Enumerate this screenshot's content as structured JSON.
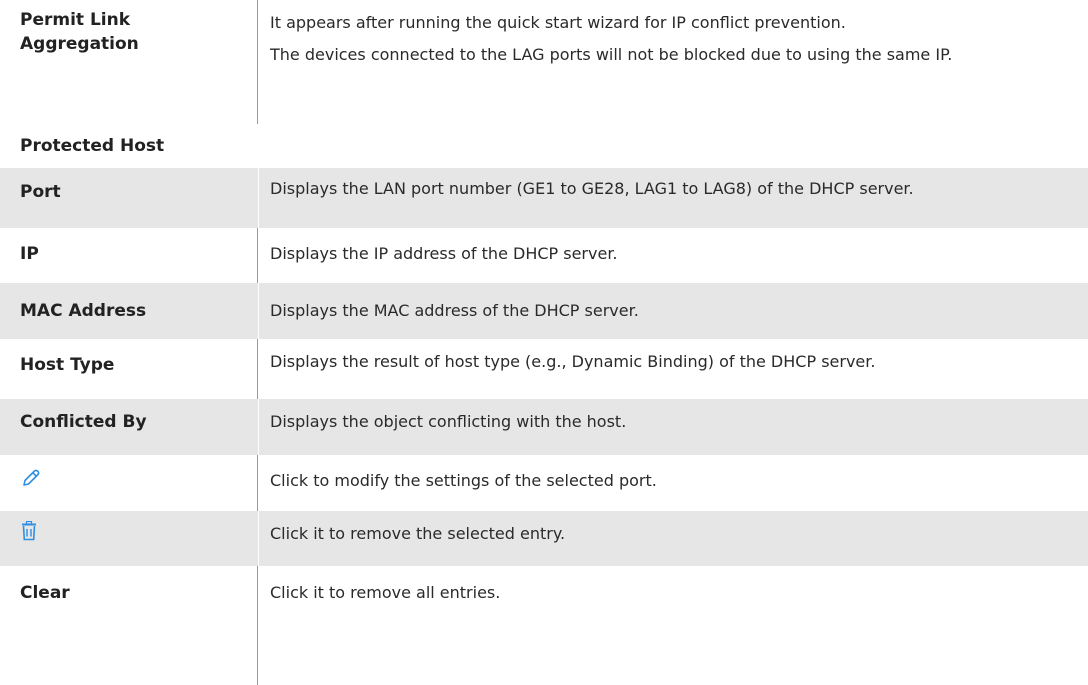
{
  "rows_top": [
    {
      "term": [
        "Permit Link",
        "Aggregation"
      ],
      "desc": [
        "It appears after running the quick start wizard for IP conflict prevention.",
        "The devices connected to the LAG ports will not be blocked due to using the same IP."
      ]
    }
  ],
  "section_title": "Protected Host",
  "rows": [
    {
      "term": "Port",
      "desc": "Displays the LAN port number (GE1 to GE28, LAG1 to LAG8) of the DHCP server."
    },
    {
      "term": "IP",
      "desc": "Displays the IP address of the DHCP server."
    },
    {
      "term": "MAC Address",
      "desc": "Displays the MAC address of the DHCP server."
    },
    {
      "term": "Host Type",
      "desc": "Displays the result of host type (e.g., Dynamic Binding) of the DHCP server."
    },
    {
      "term": "Conflicted By",
      "desc": "Displays the object conflicting with the host."
    },
    {
      "icon": "pencil-icon",
      "desc": "Click to modify the settings of the selected port."
    },
    {
      "icon": "trash-icon",
      "desc": "Click it to remove the selected entry."
    },
    {
      "term": "Clear",
      "desc": "Click it to remove all entries."
    }
  ],
  "colors": {
    "shade": "#e6e6e6",
    "icon_blue": "#2f8fe0",
    "border": "#9a9a9a"
  }
}
